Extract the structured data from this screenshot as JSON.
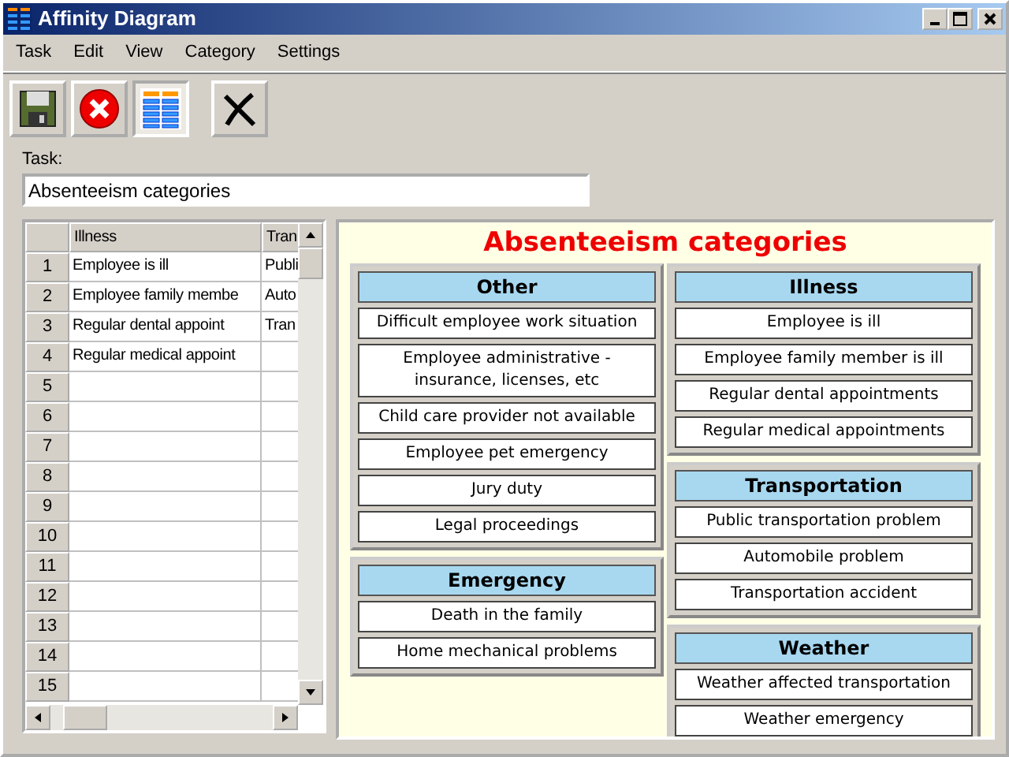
{
  "window": {
    "title": "Affinity Diagram"
  },
  "menu": [
    "Task",
    "Edit",
    "View",
    "Category",
    "Settings"
  ],
  "toolbar": [
    {
      "kind": "save",
      "selected": false
    },
    {
      "kind": "cancel",
      "selected": false
    },
    {
      "kind": "diagram",
      "selected": true
    },
    {
      "kind": "delete",
      "selected": false
    }
  ],
  "task": {
    "label": "Task:",
    "value": "Absenteeism categories"
  },
  "grid": {
    "columns": [
      "Illness",
      "Tran"
    ],
    "rows": [
      {
        "number": "1",
        "cells": [
          "Employee is ill",
          "Publi"
        ]
      },
      {
        "number": "2",
        "cells": [
          "Employee family membe",
          "Auto"
        ]
      },
      {
        "number": "3",
        "cells": [
          "Regular dental appoint",
          "Tran"
        ]
      },
      {
        "number": "4",
        "cells": [
          "Regular medical appoint",
          ""
        ]
      },
      {
        "number": "5",
        "cells": [
          "",
          ""
        ]
      },
      {
        "number": "6",
        "cells": [
          "",
          ""
        ]
      },
      {
        "number": "7",
        "cells": [
          "",
          ""
        ]
      },
      {
        "number": "8",
        "cells": [
          "",
          ""
        ]
      },
      {
        "number": "9",
        "cells": [
          "",
          ""
        ]
      },
      {
        "number": "10",
        "cells": [
          "",
          ""
        ]
      },
      {
        "number": "11",
        "cells": [
          "",
          ""
        ]
      },
      {
        "number": "12",
        "cells": [
          "",
          ""
        ]
      },
      {
        "number": "13",
        "cells": [
          "",
          ""
        ]
      },
      {
        "number": "14",
        "cells": [
          "",
          ""
        ]
      },
      {
        "number": "15",
        "cells": [
          "",
          ""
        ]
      }
    ]
  },
  "diagram": {
    "title": "Absenteeism categories",
    "columns": [
      [
        {
          "title": "Other",
          "items": [
            "Difficult employee work situation",
            "Employee administrative - insurance, licenses, etc",
            "Child care provider not available",
            "Employee pet emergency",
            "Jury duty",
            "Legal proceedings"
          ]
        },
        {
          "title": "Emergency",
          "items": [
            "Death in the family",
            "Home mechanical problems"
          ]
        }
      ],
      [
        {
          "title": "Illness",
          "items": [
            "Employee is ill",
            "Employee family member is ill",
            "Regular dental appointments",
            "Regular medical appointments"
          ]
        },
        {
          "title": "Transportation",
          "items": [
            "Public transportation problem",
            "Automobile problem",
            "Transportation accident"
          ]
        },
        {
          "title": "Weather",
          "items": [
            "Weather affected transportation",
            "Weather emergency"
          ]
        }
      ]
    ]
  }
}
